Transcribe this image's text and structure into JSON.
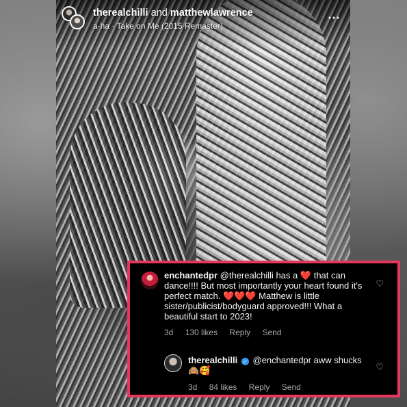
{
  "post": {
    "user1": "therealchilli",
    "conjunction": "and",
    "user2": "matthewlawrence",
    "song": "a-ha · Take on Me (2015 Remaster)",
    "more_icon": "⋯"
  },
  "comments": [
    {
      "username": "enchantedpr",
      "text_a": "@therealchilli has a ",
      "text_b": " that can dance!!!! But most importantly your heart found it's perfect match. ",
      "text_c": " Matthew is little sister/publicist/bodyguard approved!!! What a beautiful start to 2023!",
      "heart_emoji": "❤️",
      "triple_hearts": "❤️❤️❤️",
      "age": "3d",
      "likes": "130 likes",
      "reply": "Reply",
      "send": "Send"
    },
    {
      "username": "therealchilli",
      "verified_icon": "✓",
      "text": "@enchantedpr aww shucks",
      "emojis": "🙈🥰",
      "age": "3d",
      "likes": "84 likes",
      "reply": "Reply",
      "send": "Send"
    }
  ],
  "colors": {
    "highlight_border": "#e8375c",
    "verified": "#3897f0"
  }
}
